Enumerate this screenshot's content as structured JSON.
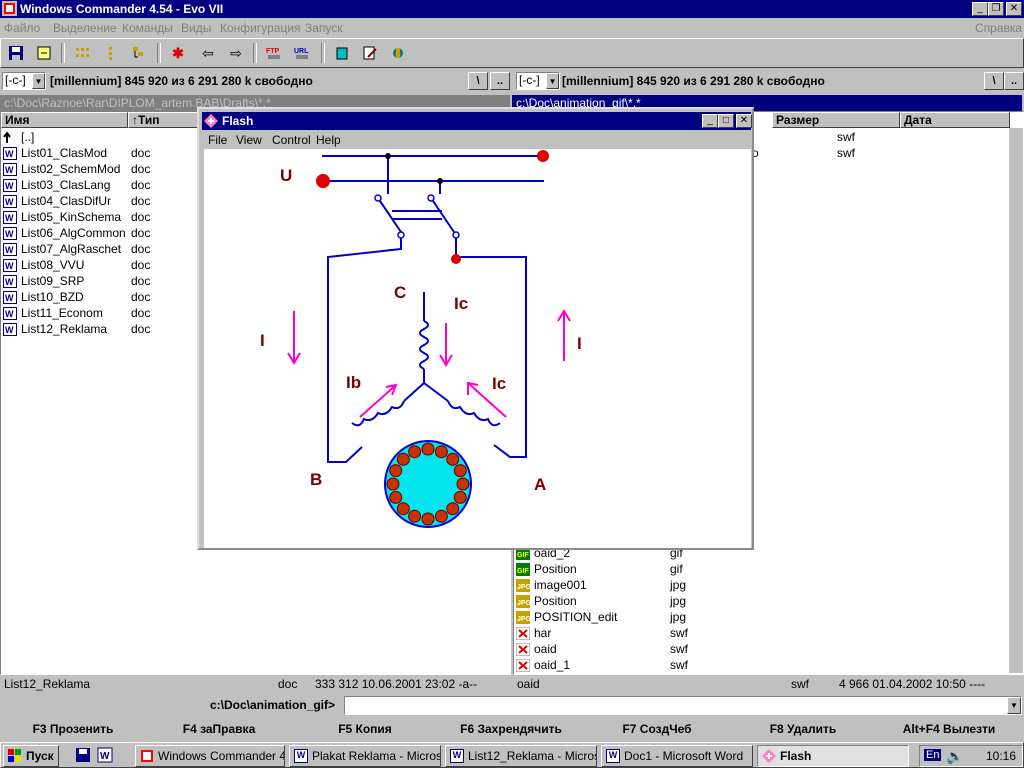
{
  "app": {
    "title": "Windows Commander 4.54 - Evo VII",
    "menu": [
      "Файло",
      "Выделение",
      "Команды",
      "Виды",
      "Конфигурация",
      "Запуск"
    ],
    "help": "Справка"
  },
  "toolbar": {
    "icons": [
      "save-icon",
      "refresh-icon",
      "grid-view-icon",
      "tree-view-icon",
      "compare-icon",
      "asterisk-icon",
      "back-arrow-icon",
      "forward-arrow-icon",
      "ftp-connect-icon",
      "ftp-upload-icon",
      "copy-icon",
      "edit-icon",
      "pack-icon"
    ]
  },
  "left": {
    "drive": "[-c-]",
    "info": "[millennium]  845 920 из 6 291 280 k свободно",
    "root_btn": "\\",
    "up_btn": "..",
    "path": "c:\\Doc\\Raznoe\\Rar\\DIPLOM_artem.BAB\\Drafts\\*.*",
    "col_name": "Имя",
    "col_type": "↑Тип",
    "files": [
      {
        "name": "[..]",
        "ext": ""
      },
      {
        "name": "List01_ClasMod",
        "ext": "doc"
      },
      {
        "name": "List02_SchemMod",
        "ext": "doc"
      },
      {
        "name": "List03_ClasLang",
        "ext": "doc"
      },
      {
        "name": "List04_ClasDifUr",
        "ext": "doc"
      },
      {
        "name": "List05_KinSchema",
        "ext": "doc"
      },
      {
        "name": "List06_AlgCommon",
        "ext": "doc"
      },
      {
        "name": "List07_AlgRaschet",
        "ext": "doc"
      },
      {
        "name": "List08_VVU",
        "ext": "doc"
      },
      {
        "name": "List09_SRP",
        "ext": "doc"
      },
      {
        "name": "List10_BZD",
        "ext": "doc"
      },
      {
        "name": "List11_Econom",
        "ext": "doc"
      },
      {
        "name": "List12_Reklama",
        "ext": "doc"
      }
    ],
    "status": {
      "name": "List12_Reklama",
      "ext": "doc",
      "details": "333 312 10.06.2001 23:02 -a--"
    }
  },
  "right": {
    "drive": "[-c-]",
    "info": "[millennium]  845 920 из 6 291 280 k свободно",
    "root_btn": "\\",
    "up_btn": "..",
    "path": "c:\\Doc\\animation_gif\\*.*",
    "col_size": "Размер",
    "col_date": "Дата",
    "top_rows": [
      {
        "name": "",
        "ext": "swf"
      },
      {
        "name": "o",
        "ext": "swf"
      }
    ],
    "files": [
      {
        "name": "oaid_2",
        "ext": "gif",
        "icon": "gif"
      },
      {
        "name": "Position",
        "ext": "gif",
        "icon": "gif"
      },
      {
        "name": "image001",
        "ext": "jpg",
        "icon": "jpg"
      },
      {
        "name": "Position",
        "ext": "jpg",
        "icon": "jpg"
      },
      {
        "name": "POSITION_edit",
        "ext": "jpg",
        "icon": "jpg"
      },
      {
        "name": "har",
        "ext": "swf",
        "icon": "swf"
      },
      {
        "name": "oaid",
        "ext": "swf",
        "icon": "swf"
      },
      {
        "name": "oaid_1",
        "ext": "swf",
        "icon": "swf"
      }
    ],
    "status": {
      "name": "oaid",
      "ext": "swf",
      "details": "4 966 01.04.2002 10:50 ----"
    }
  },
  "cmdline": {
    "label": "c:\\Doc\\animation_gif>",
    "value": ""
  },
  "fkeys": [
    "F3 Прозенить",
    "F4 заПравка",
    "F5 Копия",
    "F6 Захрендячить",
    "F7 СоздЧеб",
    "F8 Удалить",
    "Alt+F4 Вылезти"
  ],
  "flash": {
    "title": "Flash",
    "menu": [
      "File",
      "View",
      "Control",
      "Help"
    ],
    "labels": {
      "U": "U",
      "C": "C",
      "B": "B",
      "A": "A",
      "I_left": "I",
      "I_right": "I",
      "Ic_top": "Ic",
      "Ib": "Ib",
      "Ic_right": "Ic"
    },
    "colors": {
      "wire": "#0000cc",
      "node": "#e00000",
      "arrow": "#ff00cc",
      "label": "#800000",
      "rotor": "#00e5ee",
      "pole": "#c83200"
    }
  },
  "taskbar": {
    "start": "Пуск",
    "tasks": [
      "Windows Commander 4...",
      "Plakat Reklama - Micros...",
      "List12_Reklama - Micros...",
      "Doc1 - Microsoft Word",
      "Flash"
    ],
    "lang": "En",
    "time": "10:16"
  }
}
